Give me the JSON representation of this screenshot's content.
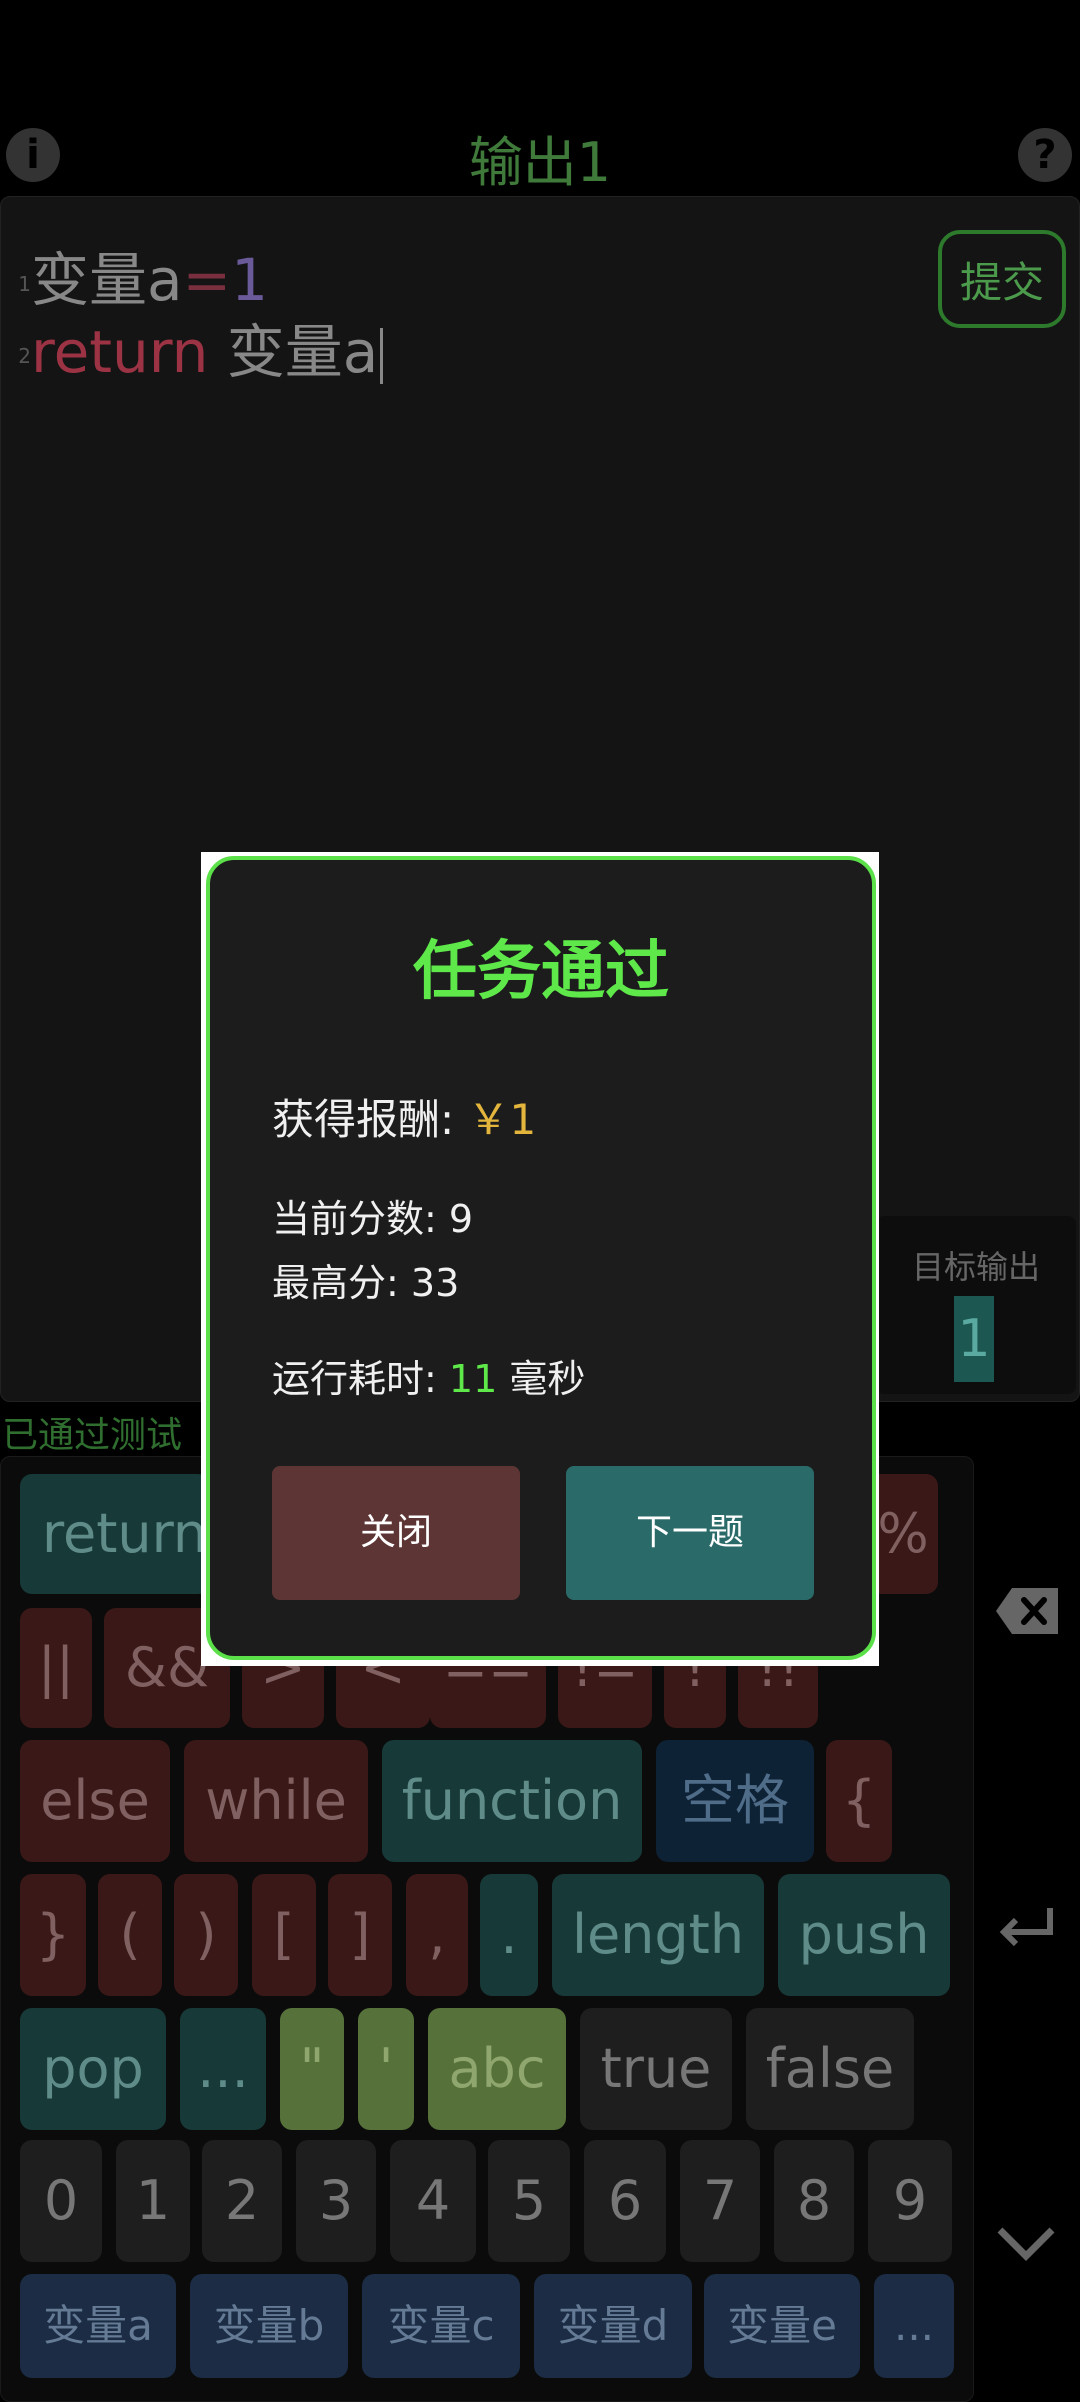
{
  "header": {
    "title": "输出1",
    "info_icon": "i",
    "help_icon": "?"
  },
  "editor": {
    "line1": {
      "num": "1",
      "var": "变量a",
      "op": "=",
      "value": "1"
    },
    "line2": {
      "num": "2",
      "keyword": "return",
      "var": "变量a"
    },
    "submit_label": "提交"
  },
  "target": {
    "label": "目标输出",
    "value": "1"
  },
  "status": {
    "passed_text": "已通过测试"
  },
  "keyboard": {
    "row1": [
      "return",
      "%"
    ],
    "row2": [
      "||",
      "&&",
      ">",
      "<",
      "==",
      "!=",
      "!",
      "!!"
    ],
    "row3": [
      "else",
      "while",
      "function",
      "空格",
      "{"
    ],
    "row4": [
      "}",
      "(",
      ")",
      "[",
      "]",
      ",",
      ".",
      "length",
      "push"
    ],
    "row5": [
      "pop",
      "...",
      "\"",
      "'",
      "abc",
      "true",
      "false"
    ],
    "row6": [
      "0",
      "1",
      "2",
      "3",
      "4",
      "5",
      "6",
      "7",
      "8",
      "9"
    ],
    "row7": [
      "变量a",
      "变量b",
      "变量c",
      "变量d",
      "变量e",
      "..."
    ],
    "side": {
      "backspace": "✕",
      "enter": "↵",
      "hide": "⌄"
    }
  },
  "dialog": {
    "title": "任务通过",
    "reward_label": "获得报酬: ",
    "reward_value": "￥1",
    "score_label": "当前分数: ",
    "score_value": "9",
    "best_label": "最高分: ",
    "best_value": "33",
    "time_label": "运行耗时: ",
    "time_value": "11",
    "time_unit": " 毫秒",
    "close_label": "关闭",
    "next_label": "下一题"
  },
  "colors": {
    "accent": "#5ee84a",
    "close_bg": "#5e3535",
    "next_bg": "#2a6b69"
  }
}
